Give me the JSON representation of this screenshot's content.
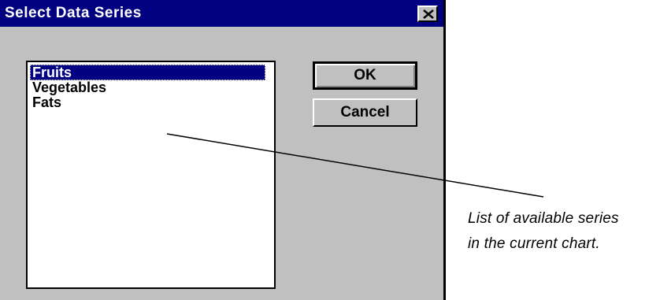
{
  "dialog": {
    "title": "Select Data Series",
    "close_icon": "close-x-icon"
  },
  "series_list": {
    "items": [
      {
        "label": "Fruits",
        "selected": true
      },
      {
        "label": "Vegetables",
        "selected": false
      },
      {
        "label": "Fats",
        "selected": false
      }
    ]
  },
  "buttons": {
    "ok_label": "OK",
    "cancel_label": "Cancel"
  },
  "annotation": {
    "line1": "List of available series",
    "line2": "in the current chart."
  },
  "colors": {
    "title_bar": "#000080",
    "dialog_bg": "#c0c0c0",
    "selection": "#000080"
  }
}
